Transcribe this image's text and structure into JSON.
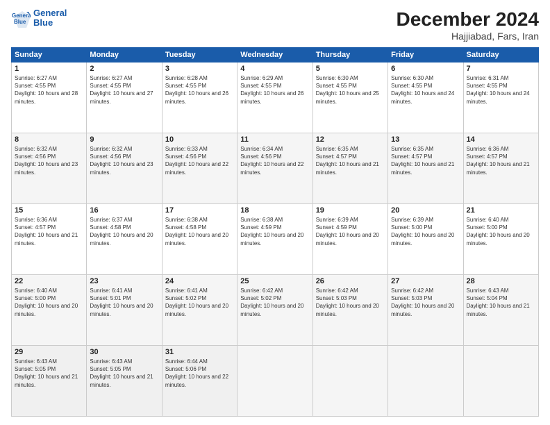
{
  "logo": {
    "line1": "General",
    "line2": "Blue"
  },
  "title": "December 2024",
  "subtitle": "Hajjiabad, Fars, Iran",
  "weekdays": [
    "Sunday",
    "Monday",
    "Tuesday",
    "Wednesday",
    "Thursday",
    "Friday",
    "Saturday"
  ],
  "weeks": [
    [
      {
        "day": "1",
        "sunrise": "6:27 AM",
        "sunset": "4:55 PM",
        "daylight": "10 hours and 28 minutes."
      },
      {
        "day": "2",
        "sunrise": "6:27 AM",
        "sunset": "4:55 PM",
        "daylight": "10 hours and 27 minutes."
      },
      {
        "day": "3",
        "sunrise": "6:28 AM",
        "sunset": "4:55 PM",
        "daylight": "10 hours and 26 minutes."
      },
      {
        "day": "4",
        "sunrise": "6:29 AM",
        "sunset": "4:55 PM",
        "daylight": "10 hours and 26 minutes."
      },
      {
        "day": "5",
        "sunrise": "6:30 AM",
        "sunset": "4:55 PM",
        "daylight": "10 hours and 25 minutes."
      },
      {
        "day": "6",
        "sunrise": "6:30 AM",
        "sunset": "4:55 PM",
        "daylight": "10 hours and 24 minutes."
      },
      {
        "day": "7",
        "sunrise": "6:31 AM",
        "sunset": "4:55 PM",
        "daylight": "10 hours and 24 minutes."
      }
    ],
    [
      {
        "day": "8",
        "sunrise": "6:32 AM",
        "sunset": "4:56 PM",
        "daylight": "10 hours and 23 minutes."
      },
      {
        "day": "9",
        "sunrise": "6:32 AM",
        "sunset": "4:56 PM",
        "daylight": "10 hours and 23 minutes."
      },
      {
        "day": "10",
        "sunrise": "6:33 AM",
        "sunset": "4:56 PM",
        "daylight": "10 hours and 22 minutes."
      },
      {
        "day": "11",
        "sunrise": "6:34 AM",
        "sunset": "4:56 PM",
        "daylight": "10 hours and 22 minutes."
      },
      {
        "day": "12",
        "sunrise": "6:35 AM",
        "sunset": "4:57 PM",
        "daylight": "10 hours and 21 minutes."
      },
      {
        "day": "13",
        "sunrise": "6:35 AM",
        "sunset": "4:57 PM",
        "daylight": "10 hours and 21 minutes."
      },
      {
        "day": "14",
        "sunrise": "6:36 AM",
        "sunset": "4:57 PM",
        "daylight": "10 hours and 21 minutes."
      }
    ],
    [
      {
        "day": "15",
        "sunrise": "6:36 AM",
        "sunset": "4:57 PM",
        "daylight": "10 hours and 21 minutes."
      },
      {
        "day": "16",
        "sunrise": "6:37 AM",
        "sunset": "4:58 PM",
        "daylight": "10 hours and 20 minutes."
      },
      {
        "day": "17",
        "sunrise": "6:38 AM",
        "sunset": "4:58 PM",
        "daylight": "10 hours and 20 minutes."
      },
      {
        "day": "18",
        "sunrise": "6:38 AM",
        "sunset": "4:59 PM",
        "daylight": "10 hours and 20 minutes."
      },
      {
        "day": "19",
        "sunrise": "6:39 AM",
        "sunset": "4:59 PM",
        "daylight": "10 hours and 20 minutes."
      },
      {
        "day": "20",
        "sunrise": "6:39 AM",
        "sunset": "5:00 PM",
        "daylight": "10 hours and 20 minutes."
      },
      {
        "day": "21",
        "sunrise": "6:40 AM",
        "sunset": "5:00 PM",
        "daylight": "10 hours and 20 minutes."
      }
    ],
    [
      {
        "day": "22",
        "sunrise": "6:40 AM",
        "sunset": "5:00 PM",
        "daylight": "10 hours and 20 minutes."
      },
      {
        "day": "23",
        "sunrise": "6:41 AM",
        "sunset": "5:01 PM",
        "daylight": "10 hours and 20 minutes."
      },
      {
        "day": "24",
        "sunrise": "6:41 AM",
        "sunset": "5:02 PM",
        "daylight": "10 hours and 20 minutes."
      },
      {
        "day": "25",
        "sunrise": "6:42 AM",
        "sunset": "5:02 PM",
        "daylight": "10 hours and 20 minutes."
      },
      {
        "day": "26",
        "sunrise": "6:42 AM",
        "sunset": "5:03 PM",
        "daylight": "10 hours and 20 minutes."
      },
      {
        "day": "27",
        "sunrise": "6:42 AM",
        "sunset": "5:03 PM",
        "daylight": "10 hours and 20 minutes."
      },
      {
        "day": "28",
        "sunrise": "6:43 AM",
        "sunset": "5:04 PM",
        "daylight": "10 hours and 21 minutes."
      }
    ],
    [
      {
        "day": "29",
        "sunrise": "6:43 AM",
        "sunset": "5:05 PM",
        "daylight": "10 hours and 21 minutes."
      },
      {
        "day": "30",
        "sunrise": "6:43 AM",
        "sunset": "5:05 PM",
        "daylight": "10 hours and 21 minutes."
      },
      {
        "day": "31",
        "sunrise": "6:44 AM",
        "sunset": "5:06 PM",
        "daylight": "10 hours and 22 minutes."
      },
      null,
      null,
      null,
      null
    ]
  ]
}
